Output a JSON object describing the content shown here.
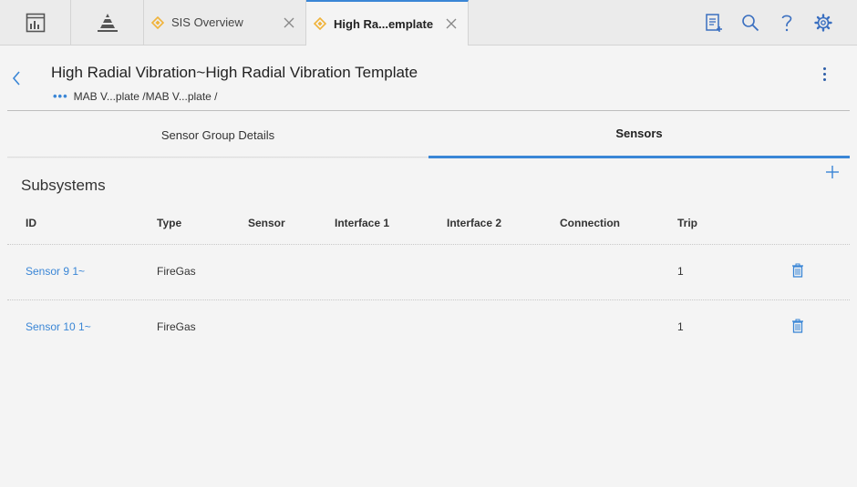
{
  "tabs": [
    {
      "label": "SIS Overview",
      "active": false
    },
    {
      "label": "High Ra...emplate",
      "active": true
    }
  ],
  "header": {
    "title": "High Radial Vibration~High Radial Vibration Template",
    "breadcrumb": "MAB V...plate /MAB V...plate /"
  },
  "subtabs": [
    "Sensor Group Details",
    "Sensors"
  ],
  "section": {
    "title": "Subsystems"
  },
  "table": {
    "columns": [
      "ID",
      "Type",
      "Sensor",
      "Interface 1",
      "Interface 2",
      "Connection",
      "Trip"
    ],
    "rows": [
      {
        "id": "Sensor 9 1~",
        "type": "FireGas",
        "sensor": "",
        "interface1": "",
        "interface2": "",
        "connection": "",
        "trip": "1"
      },
      {
        "id": "Sensor 10 1~",
        "type": "FireGas",
        "sensor": "",
        "interface1": "",
        "interface2": "",
        "connection": "",
        "trip": "1"
      }
    ]
  },
  "colors": {
    "accent": "#3a86d6",
    "diamond": "#f0b33a"
  }
}
